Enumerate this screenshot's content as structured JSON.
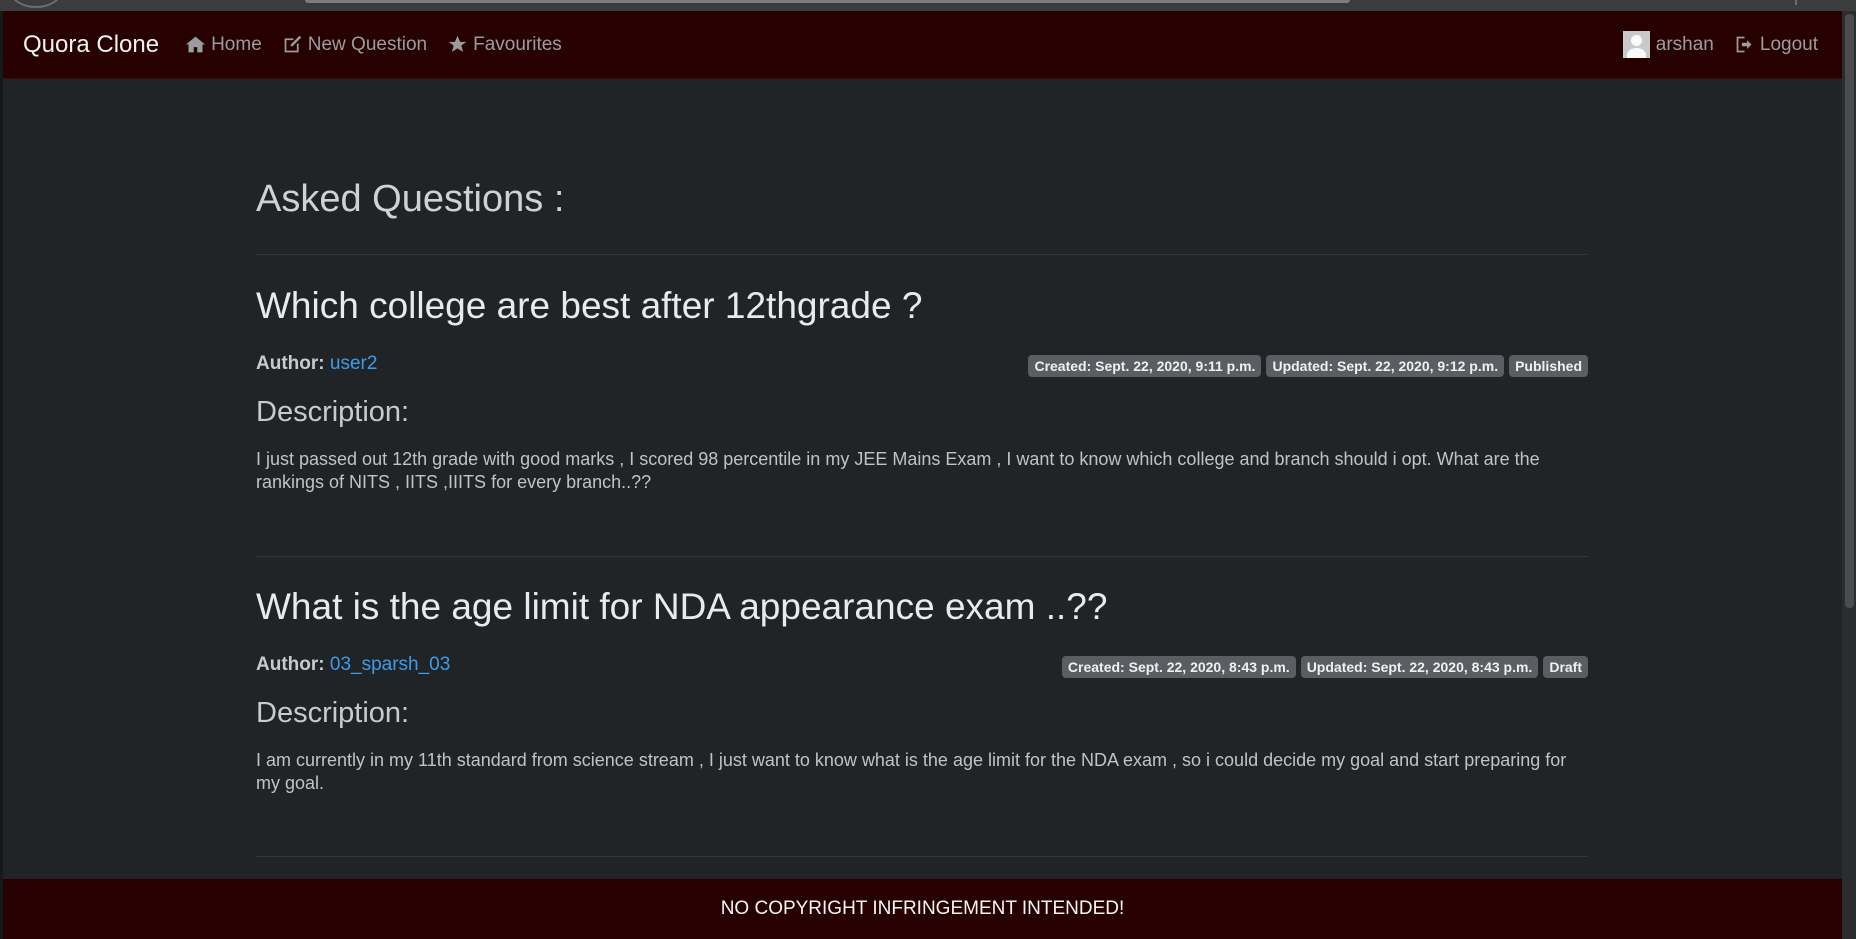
{
  "navbar": {
    "brand": "Quora Clone",
    "links": [
      {
        "label": "Home",
        "icon": "home-icon"
      },
      {
        "label": "New Question",
        "icon": "edit-icon"
      },
      {
        "label": "Favourites",
        "icon": "star-icon"
      }
    ],
    "user": {
      "name": "arshan",
      "avatar_icon": "user-avatar-icon"
    },
    "logout_label": "Logout"
  },
  "main": {
    "title": "Asked Questions :",
    "questions": [
      {
        "title": "Which college are best after 12thgrade ?",
        "author_label": "Author:",
        "author": "user2",
        "created": "Created: Sept. 22, 2020, 9:11 p.m.",
        "updated": "Updated: Sept. 22, 2020, 9:12 p.m.",
        "status": "Published",
        "description_label": "Description:",
        "description": "I just passed out 12th grade with good marks , I scored 98 percentile in my JEE Mains Exam , I want to know which college and branch should i opt. What are the rankings of NITS , IITS ,IIITS for every branch..??"
      },
      {
        "title": "What is the age limit for NDA appearance exam ..??",
        "author_label": "Author:",
        "author": "03_sparsh_03",
        "created": "Created: Sept. 22, 2020, 8:43 p.m.",
        "updated": "Updated: Sept. 22, 2020, 8:43 p.m.",
        "status": "Draft",
        "description_label": "Description:",
        "description": "I am currently in my 11th standard from science stream , I just want to know what is the age limit for the NDA exam , so i could decide my goal and start preparing for my goal."
      }
    ]
  },
  "footer": {
    "text": "NO COPYRIGHT INFRINGEMENT INTENDED!"
  },
  "colors": {
    "navbar_bg": "#270000",
    "page_bg": "#212426",
    "link": "#3d9be9",
    "badge_bg": "#5a5e62"
  }
}
